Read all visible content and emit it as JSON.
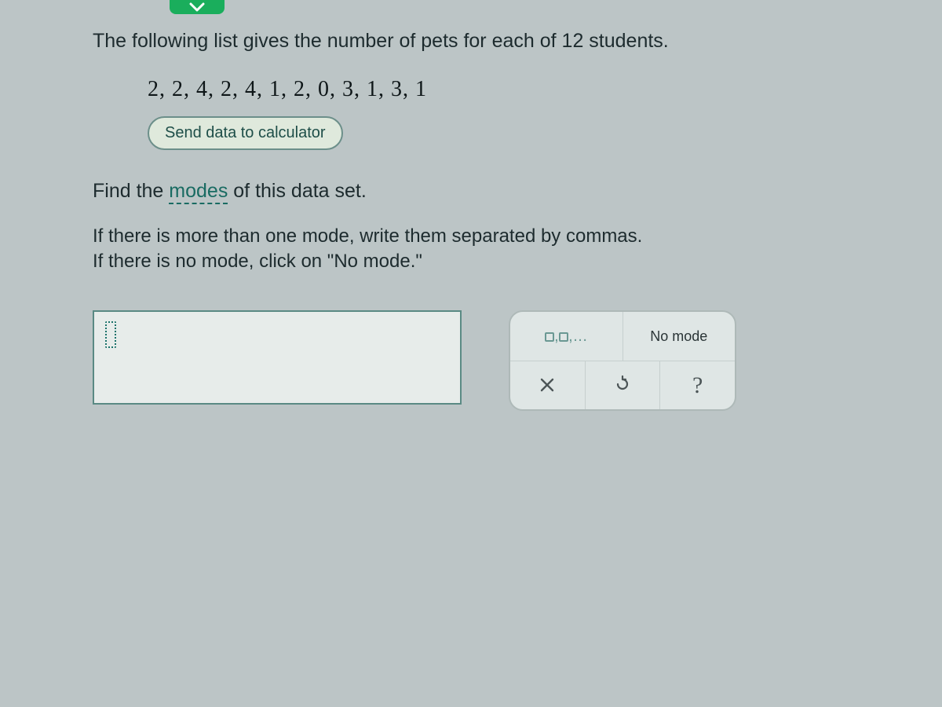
{
  "question": {
    "intro": "The following list gives the number of pets for each of 12 students.",
    "data_values": "2, 2, 4, 2, 4, 1, 2, 0, 3, 1, 3, 1",
    "send_button": "Send data to calculator",
    "prompt_prefix": "Find the ",
    "prompt_term": "modes",
    "prompt_suffix": " of this data set.",
    "hint_line1": "If there is more than one mode, write them separated by commas.",
    "hint_line2": "If there is no mode, click on \"No mode.\""
  },
  "answer": {
    "current_value": ""
  },
  "toolbox": {
    "list_template_label": "▢,▢,...",
    "no_mode_label": "No mode",
    "clear_label": "×",
    "undo_label": "↺",
    "help_label": "?"
  }
}
